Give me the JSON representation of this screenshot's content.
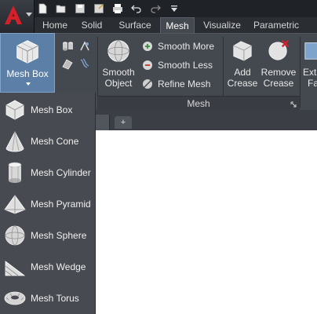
{
  "colors": {
    "ribbon_bg": "#44484f",
    "dropdown_bg": "#474a50",
    "active_blue": "#5b7fa7",
    "accent_red": "#d3202a"
  },
  "app_button": {
    "icon": "autocad-logo-icon"
  },
  "quick_access": {
    "icons": [
      "new-file-icon",
      "open-folder-icon",
      "save-icon",
      "save-as-icon",
      "print-icon",
      "undo-icon",
      "redo-icon",
      "customize-dropdown-icon"
    ]
  },
  "tabs": [
    {
      "label": "Home",
      "active": false
    },
    {
      "label": "Solid",
      "active": false
    },
    {
      "label": "Surface",
      "active": false
    },
    {
      "label": "Mesh",
      "active": true
    },
    {
      "label": "Visualize",
      "active": false
    },
    {
      "label": "Parametric",
      "active": false
    }
  ],
  "ribbon": {
    "primitives": {
      "mesh_box_label": "Mesh Box"
    },
    "mesh_panel": {
      "title": "Mesh",
      "smooth_object": {
        "line1": "Smooth",
        "line2": "Object"
      },
      "smooth_more": "Smooth More",
      "smooth_less": "Smooth Less",
      "refine_mesh": "Refine Mesh",
      "add_crease": {
        "line1": "Add",
        "line2": "Crease"
      },
      "remove_crease": {
        "line1": "Remove",
        "line2": "Crease"
      },
      "extract_partial": {
        "line1": "Extr",
        "line2": "Fa"
      }
    }
  },
  "dropdown_items": [
    {
      "label": "Mesh Box",
      "icon": "mesh-box-icon"
    },
    {
      "label": "Mesh Cone",
      "icon": "mesh-cone-icon"
    },
    {
      "label": "Mesh Cylinder",
      "icon": "mesh-cylinder-icon"
    },
    {
      "label": "Mesh Pyramid",
      "icon": "mesh-pyramid-icon"
    },
    {
      "label": "Mesh Sphere",
      "icon": "mesh-sphere-icon"
    },
    {
      "label": "Mesh Wedge",
      "icon": "mesh-wedge-icon"
    },
    {
      "label": "Mesh Torus",
      "icon": "mesh-torus-icon"
    }
  ],
  "doc_tabs": {
    "new_tab": "+"
  }
}
